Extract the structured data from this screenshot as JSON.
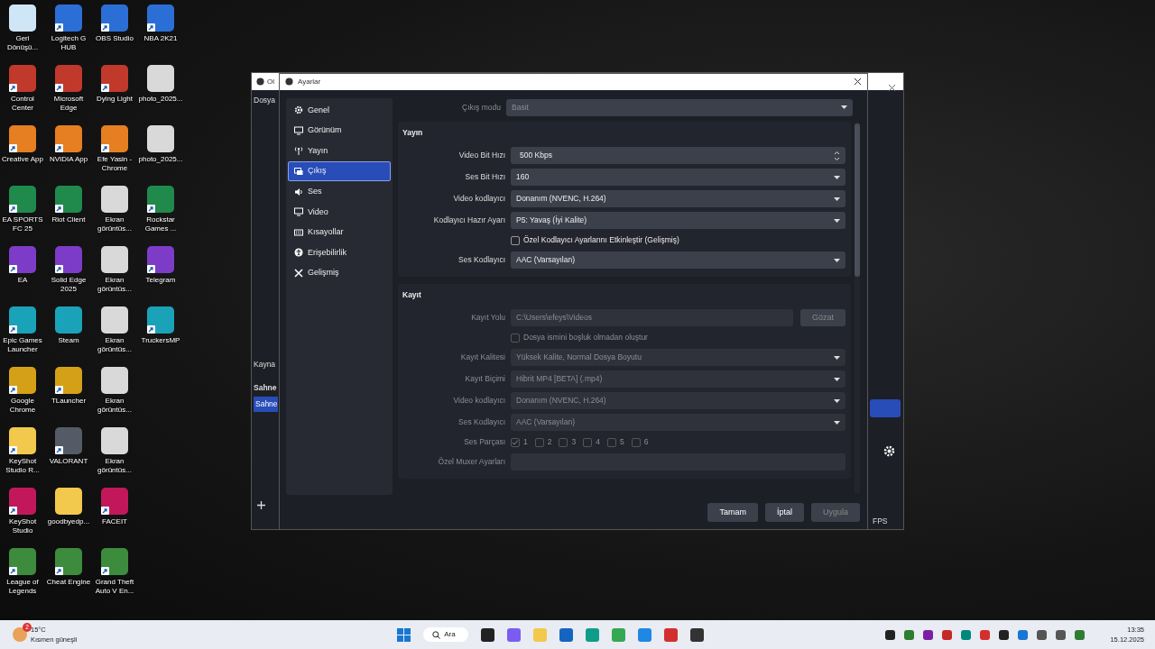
{
  "desktop_icons": [
    {
      "label": "Geri Dönüşü...",
      "kind": "bin",
      "shortcut": false
    },
    {
      "label": "Control Center",
      "kind": "app",
      "shortcut": true
    },
    {
      "label": "Creative App",
      "kind": "app",
      "shortcut": true
    },
    {
      "label": "EA SPORTS FC 25",
      "kind": "app",
      "shortcut": true
    },
    {
      "label": "EA",
      "kind": "app",
      "shortcut": true
    },
    {
      "label": "Epic Games Launcher",
      "kind": "app",
      "shortcut": true
    },
    {
      "label": "Google Chrome",
      "kind": "app",
      "shortcut": true
    },
    {
      "label": "KeyShot Studio R...",
      "kind": "folder",
      "shortcut": true
    },
    {
      "label": "KeyShot Studio",
      "kind": "app",
      "shortcut": true
    },
    {
      "label": "League of Legends",
      "kind": "app",
      "shortcut": true
    },
    {
      "label": "Logitech G HUB",
      "kind": "app",
      "shortcut": true
    },
    {
      "label": "Microsoft Edge",
      "kind": "app",
      "shortcut": true
    },
    {
      "label": "NVIDIA App",
      "kind": "app",
      "shortcut": true
    },
    {
      "label": "Riot Client",
      "kind": "app",
      "shortcut": true
    },
    {
      "label": "Solid Edge 2025",
      "kind": "app",
      "shortcut": true
    },
    {
      "label": "Steam",
      "kind": "app",
      "shortcut": false
    },
    {
      "label": "TLauncher",
      "kind": "app",
      "shortcut": true
    },
    {
      "label": "VALORANT",
      "kind": "app",
      "shortcut": true
    },
    {
      "label": "goodbyedp...",
      "kind": "folder",
      "shortcut": false
    },
    {
      "label": "Cheat Engine",
      "kind": "app",
      "shortcut": true
    },
    {
      "label": "OBS Studio",
      "kind": "app",
      "shortcut": true
    },
    {
      "label": "Dying Light",
      "kind": "app",
      "shortcut": true
    },
    {
      "label": "Efe Yasin - Chrome",
      "kind": "app",
      "shortcut": true
    },
    {
      "label": "Ekran görüntüs...",
      "kind": "image",
      "shortcut": false
    },
    {
      "label": "Ekran görüntüs...",
      "kind": "image",
      "shortcut": false
    },
    {
      "label": "Ekran görüntüs...",
      "kind": "image",
      "shortcut": false
    },
    {
      "label": "Ekran görüntüs...",
      "kind": "image",
      "shortcut": false
    },
    {
      "label": "Ekran görüntüs...",
      "kind": "image",
      "shortcut": false
    },
    {
      "label": "FACEIT",
      "kind": "app",
      "shortcut": true
    },
    {
      "label": "Grand Theft Auto V En...",
      "kind": "app",
      "shortcut": true
    },
    {
      "label": "NBA 2K21",
      "kind": "app",
      "shortcut": true
    },
    {
      "label": "photo_2025...",
      "kind": "image",
      "shortcut": false
    },
    {
      "label": "photo_2025...",
      "kind": "image",
      "shortcut": false
    },
    {
      "label": "Rockstar Games ...",
      "kind": "app",
      "shortcut": true
    },
    {
      "label": "Telegram",
      "kind": "app",
      "shortcut": true
    },
    {
      "label": "TruckersMP",
      "kind": "app",
      "shortcut": true
    }
  ],
  "obs_window": {
    "title": "Ol",
    "menu": "Dosya",
    "sources_header": "Kayna",
    "scenes_header": "Sahne",
    "scene_item": "Sahne",
    "status": "FPS"
  },
  "settings": {
    "title": "Ayarlar",
    "sidebar": [
      {
        "label": "Genel",
        "selected": false
      },
      {
        "label": "Görünüm",
        "selected": false
      },
      {
        "label": "Yayın",
        "selected": false
      },
      {
        "label": "Çıkış",
        "selected": true
      },
      {
        "label": "Ses",
        "selected": false
      },
      {
        "label": "Video",
        "selected": false
      },
      {
        "label": "Kısayollar",
        "selected": false
      },
      {
        "label": "Erişebilirlik",
        "selected": false
      },
      {
        "label": "Gelişmiş",
        "selected": false
      }
    ],
    "output_mode": {
      "label": "Çıkış modu",
      "value": "Basit"
    },
    "sections": [
      {
        "title": "Yayın",
        "disabled": false,
        "fields": [
          {
            "kind": "spin",
            "label": "Video Bit Hızı",
            "value": "500 Kbps"
          },
          {
            "kind": "select",
            "label": "Ses Bit Hızı",
            "value": "160"
          },
          {
            "kind": "select",
            "label": "Video kodlayıcı",
            "value": "Donanım (NVENC, H.264)"
          },
          {
            "kind": "select",
            "label": "Kodlayıcı Hazır Ayarı",
            "value": "P5: Yavaş (İyi Kalite)"
          },
          {
            "kind": "check",
            "text": "Özel Kodlayıcı Ayarlarını Etkinleştir (Gelişmiş)",
            "checked": false
          },
          {
            "kind": "select",
            "label": "Ses Kodlayıcı",
            "value": "AAC (Varsayılan)"
          }
        ]
      },
      {
        "title": "Kayıt",
        "disabled": true,
        "fields": [
          {
            "kind": "path",
            "label": "Kayıt Yolu",
            "value": "C:\\Users\\efeys\\Videos",
            "button": "Gözat"
          },
          {
            "kind": "check",
            "text": "Dosya ismini boşluk olmadan oluştur",
            "checked": false
          },
          {
            "kind": "select",
            "label": "Kayıt Kalitesi",
            "value": "Yüksek Kalite, Normal Dosya Boyutu"
          },
          {
            "kind": "select",
            "label": "Kayıt Biçimi",
            "value": "Hibrit MP4 [BETA] (.mp4)"
          },
          {
            "kind": "select",
            "label": "Video kodlayıcı",
            "value": "Donanım (NVENC, H.264)"
          },
          {
            "kind": "select",
            "label": "Ses Kodlayıcı",
            "value": "AAC (Varsayılan)"
          },
          {
            "kind": "tracks",
            "label": "Ses Parçası",
            "tracks": [
              {
                "label": "1",
                "checked": true
              },
              {
                "label": "2",
                "checked": false
              },
              {
                "label": "3",
                "checked": false
              },
              {
                "label": "4",
                "checked": false
              },
              {
                "label": "5",
                "checked": false
              },
              {
                "label": "6",
                "checked": false
              }
            ]
          },
          {
            "kind": "text",
            "label": "Özel Muxer Ayarları"
          }
        ]
      }
    ],
    "buttons": [
      {
        "label": "Tamam",
        "disabled": false
      },
      {
        "label": "İptal",
        "disabled": false
      },
      {
        "label": "Uygula",
        "disabled": true
      }
    ]
  },
  "taskbar": {
    "weather": {
      "badge": "2",
      "temp": "15°C",
      "condition": "Kısmen güneşli"
    },
    "search": "Ara",
    "time": "13:35",
    "date": "15.12.2025"
  }
}
